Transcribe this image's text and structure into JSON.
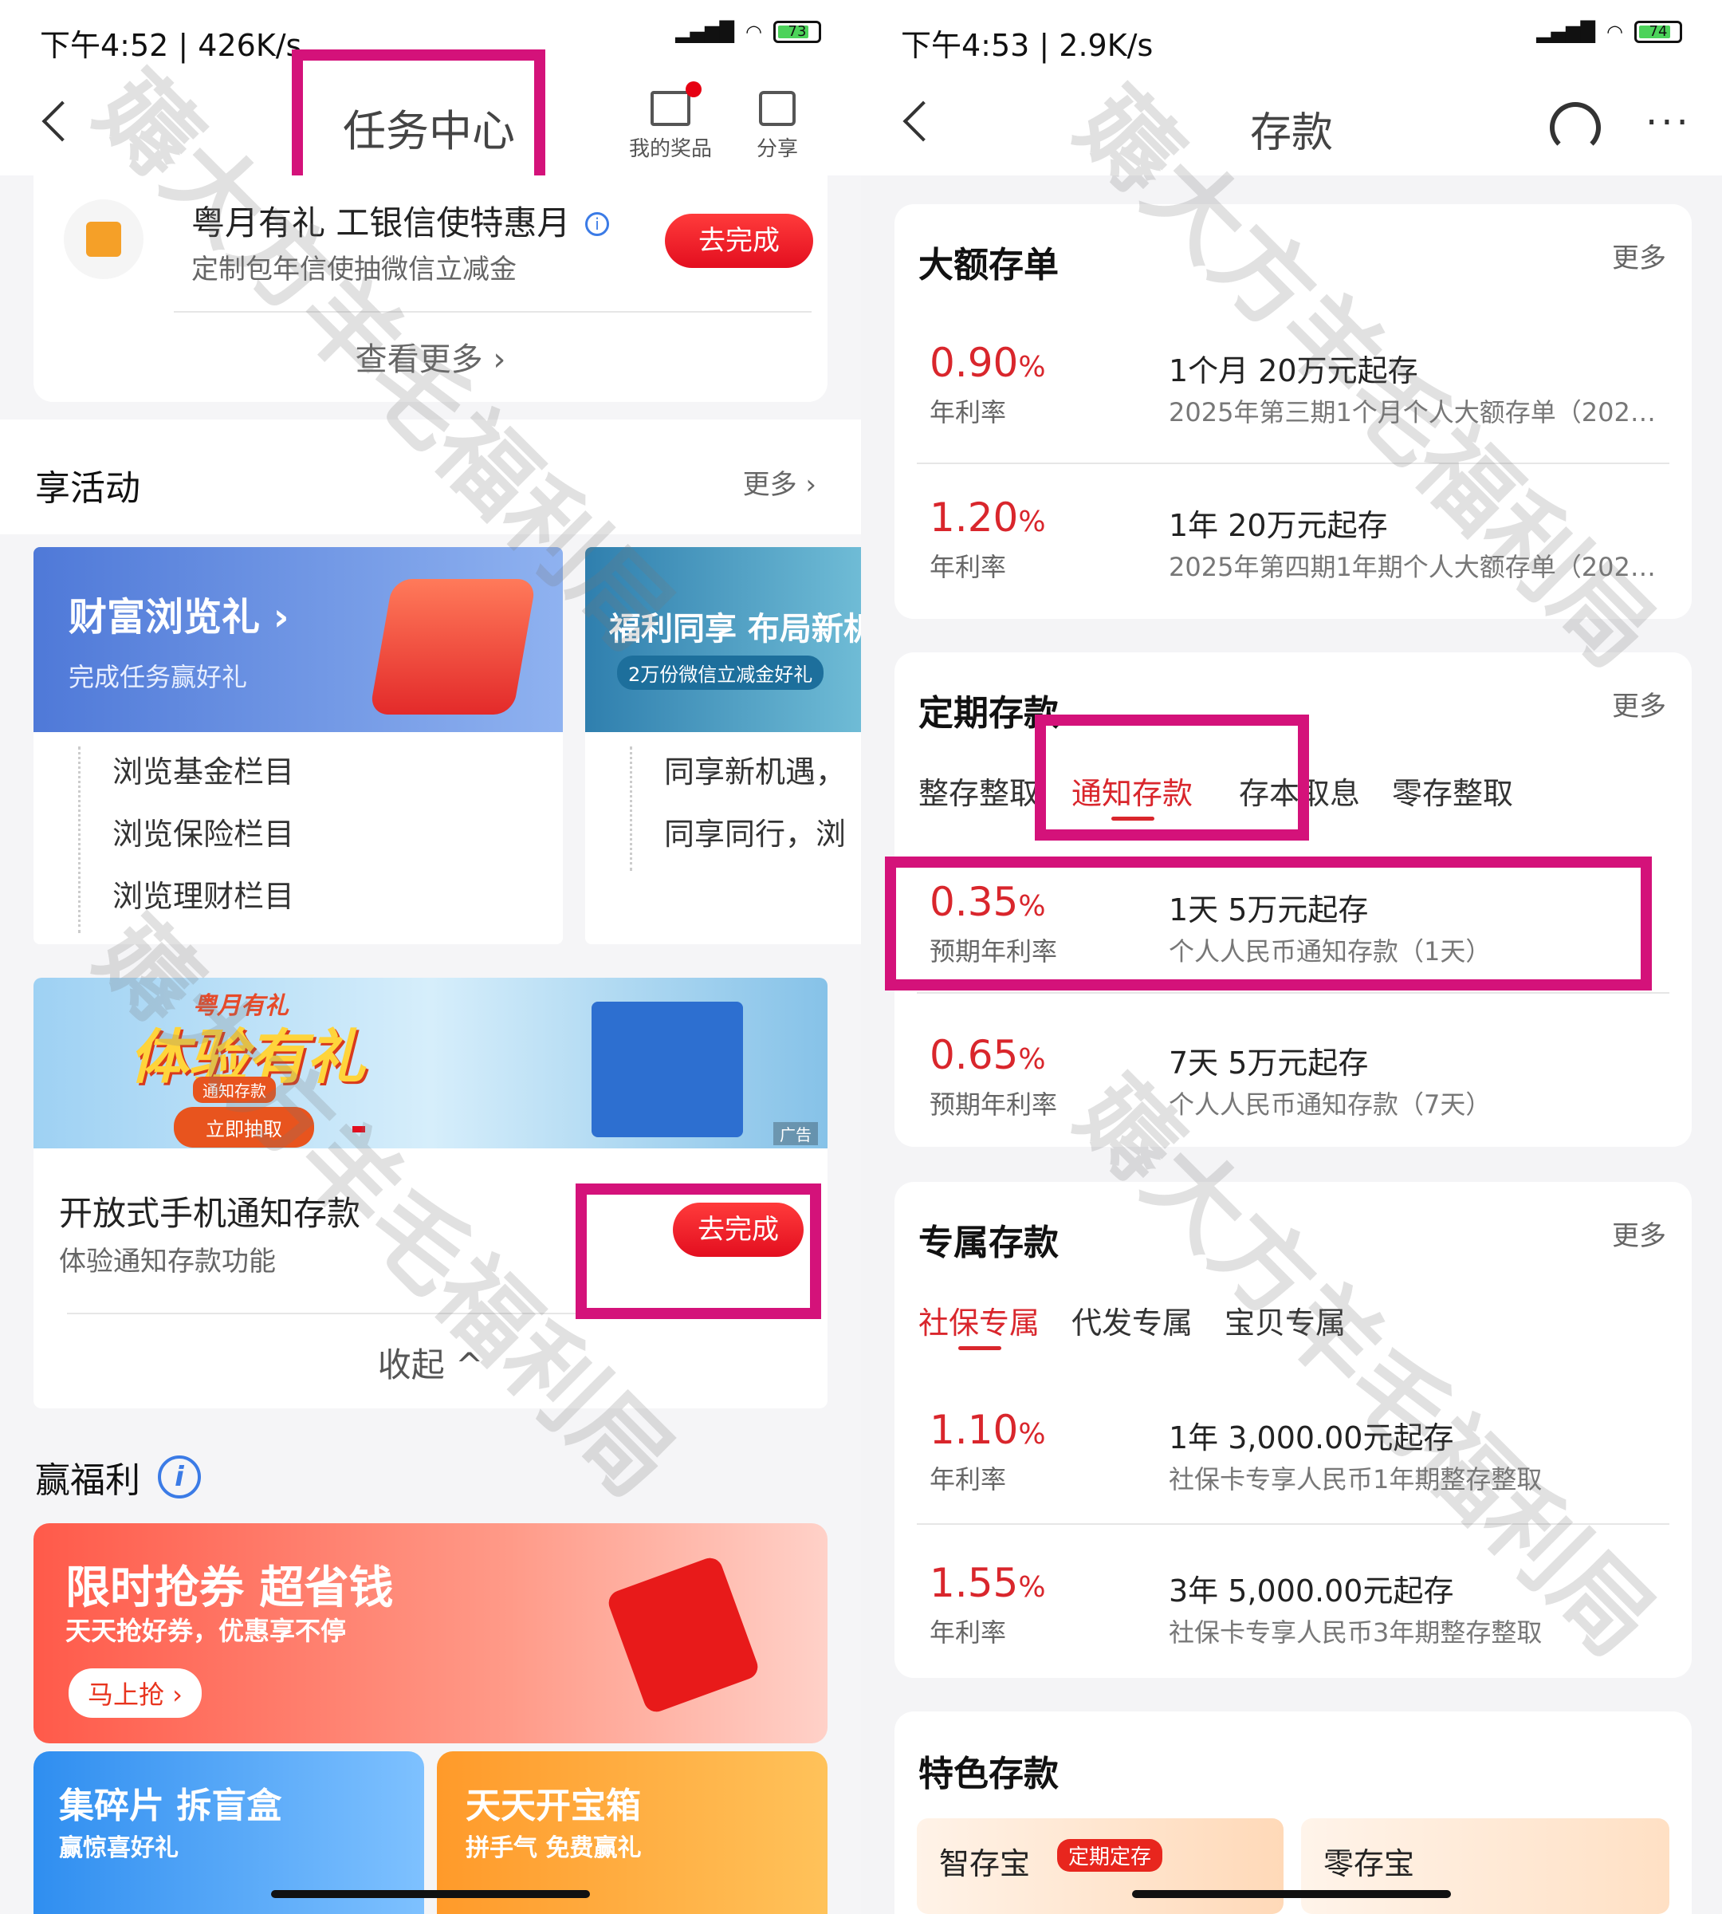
{
  "left": {
    "status": {
      "time": "下午4:52 | 426K/s",
      "battery": "73"
    },
    "nav": {
      "title": "任务中心",
      "prize_label": "我的奖品",
      "share_label": "分享"
    },
    "task_top": {
      "title": "粤月有礼 工银信使特惠月",
      "desc": "定制包年信使抽微信立减金",
      "action": "去完成",
      "see_more": "查看更多 ›"
    },
    "activities": {
      "title": "享活动",
      "more": "更多 ›",
      "cards": [
        {
          "banner_title": "财富浏览礼 ›",
          "banner_sub": "完成任务赢好礼",
          "items": [
            "浏览基金栏目",
            "浏览保险栏目",
            "浏览理财栏目"
          ]
        },
        {
          "banner_title": "福利同享 布局新机",
          "banner_sub": "2万份微信立减金好礼",
          "items": [
            "同享新机遇，",
            "同享同行，浏"
          ]
        }
      ]
    },
    "promo": {
      "title_small": "粤月有礼",
      "title": "体验有礼",
      "tag": "通知存款",
      "cta": "立即抽取",
      "ad": "广告"
    },
    "task2": {
      "title": "开放式手机通知存款",
      "desc": "体验通知存款功能",
      "action": "去完成",
      "collapse": "收起 ^"
    },
    "welfare": {
      "title": "赢福利",
      "big": {
        "title": "限时抢券 超省钱",
        "sub": "天天抢好券，优惠享不停",
        "cta": "马上抢 ›"
      },
      "small": [
        {
          "title": "集碎片 拆盲盒",
          "sub": "赢惊喜好礼"
        },
        {
          "title": "天天开宝箱",
          "sub": "拼手气 免费赢礼"
        }
      ]
    }
  },
  "right": {
    "status": {
      "time": "下午4:53 | 2.9K/s",
      "battery": "74"
    },
    "nav": {
      "title": "存款"
    },
    "large_cd": {
      "title": "大额存单",
      "more": "更多",
      "items": [
        {
          "rate": "0.90",
          "unit": "%",
          "rate_label": "年利率",
          "title": "1个月 20万元起存",
          "sub": "2025年第三期1个月个人大额存单（202…"
        },
        {
          "rate": "1.20",
          "unit": "%",
          "rate_label": "年利率",
          "title": "1年 20万元起存",
          "sub": "2025年第四期1年期个人大额存单（202…"
        }
      ]
    },
    "fixed": {
      "title": "定期存款",
      "more": "更多",
      "tabs": [
        "整存整取",
        "通知存款",
        "存本取息",
        "零存整取"
      ],
      "active_tab": 1,
      "items": [
        {
          "rate": "0.35",
          "unit": "%",
          "rate_label": "预期年利率",
          "title": "1天 5万元起存",
          "sub": "个人人民币通知存款（1天）"
        },
        {
          "rate": "0.65",
          "unit": "%",
          "rate_label": "预期年利率",
          "title": "7天 5万元起存",
          "sub": "个人人民币通知存款（7天）"
        }
      ]
    },
    "exclusive": {
      "title": "专属存款",
      "more": "更多",
      "tabs": [
        "社保专属",
        "代发专属",
        "宝贝专属"
      ],
      "items": [
        {
          "rate": "1.10",
          "unit": "%",
          "rate_label": "年利率",
          "title": "1年 3,000.00元起存",
          "sub": "社保卡专享人民币1年期整存整取"
        },
        {
          "rate": "1.55",
          "unit": "%",
          "rate_label": "年利率",
          "title": "3年 5,000.00元起存",
          "sub": "社保卡专享人民币3年期整存整取"
        }
      ]
    },
    "special": {
      "title": "特色存款",
      "items": [
        {
          "name": "智存宝",
          "badge": "定期定存"
        },
        {
          "name": "零存宝"
        }
      ]
    }
  },
  "watermark": "薅大方羊毛福利局",
  "colors": {
    "accent_red": "#d9262c",
    "highlight": "#d4127a"
  }
}
